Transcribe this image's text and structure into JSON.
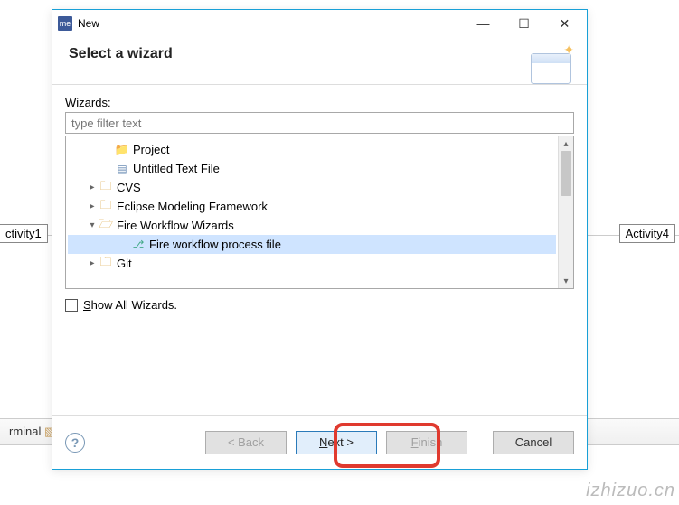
{
  "dialog": {
    "app_icon_text": "me",
    "title": "New",
    "banner_title": "Select a wizard",
    "wizards_label_pre": "W",
    "wizards_label_post": "izards:",
    "filter_placeholder": "type filter text",
    "show_all_pre": "S",
    "show_all_post": "how All Wizards."
  },
  "tree": {
    "project": "Project",
    "untitled": "Untitled Text File",
    "cvs": "CVS",
    "emf": "Eclipse Modeling Framework",
    "fire_wizards": "Fire Workflow Wizards",
    "fire_process": "Fire workflow process file",
    "git": "Git"
  },
  "buttons": {
    "back": "< Back",
    "next_pre": "N",
    "next_post": "ext >",
    "finish_pre": "F",
    "finish_post": "inish",
    "cancel": "Cancel"
  },
  "background": {
    "activity1": "ctivity1",
    "activity4": "Activity4",
    "terminal_tab": "rminal",
    "watermark": "izhizuo.cn"
  }
}
